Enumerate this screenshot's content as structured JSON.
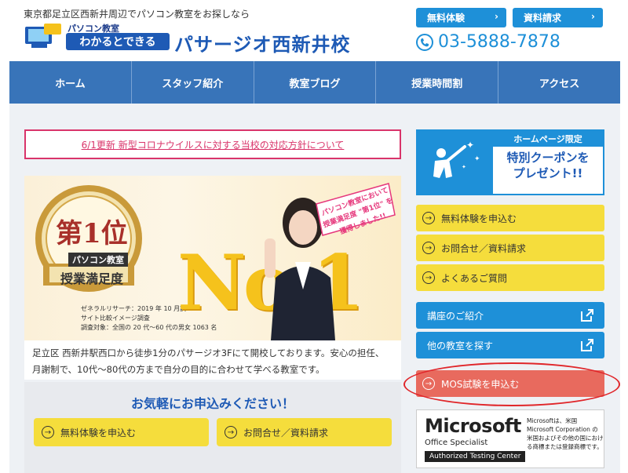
{
  "header": {
    "tagline": "東京都足立区西新井周辺でパソコン教室をお探しなら",
    "logo_top": "パソコン教室",
    "logo_main": "わかるとできる",
    "school_name": "パサージオ西新井校",
    "trial_button": "無料体験",
    "docs_button": "資料請求",
    "phone": "03-5888-7878"
  },
  "nav": {
    "items": [
      "ホーム",
      "スタッフ紹介",
      "教室ブログ",
      "授業時間割",
      "アクセス"
    ]
  },
  "notice": {
    "text": "6/1更新 新型コロナウイルスに対する当校の対応方針について"
  },
  "hero": {
    "rank_big": "第1位",
    "rank_sub": "パソコン教室",
    "rank_title": "授業満足度",
    "research_1": "ゼネラルリサーチ：2019 年 10 月調べ",
    "research_2": "サイト比較イメージ調査",
    "research_3": "調査対象：全国の 20 代～60 代の男女 1063 名",
    "big_text": "No.1",
    "bubble_1": "パソコン教室において",
    "bubble_2": "授業満足度 \"第1位\" を",
    "bubble_3": "獲得しました!!"
  },
  "description": {
    "line1": "足立区 西新井駅西口から徒歩1分のパサージオ3Fにて開校しております。安心の担任、",
    "line2": "月謝制で、10代～80代の方まで自分の目的に合わせて学べる教室です。"
  },
  "apply": {
    "title": "お気軽にお申込みください！",
    "trial": "無料体験を申込む",
    "inquiry": "お問合せ／資料請求"
  },
  "sidebar": {
    "coupon_head": "ホームページ限定",
    "coupon_body_1": "特別クーポンを",
    "coupon_body_2": "プレゼント!!",
    "trial": "無料体験を申込む",
    "inquiry": "お問合せ／資料請求",
    "faq": "よくあるご質問",
    "courses": "講座のご紹介",
    "other_schools": "他の教室を探す",
    "mos": "MOS試験を申込む"
  },
  "microsoft": {
    "logo": "Microsoft",
    "sub": "Office Specialist",
    "atc": "Authorized Testing Center",
    "note": "Microsoftは、米国 Microsoft Corporation の米国およびその他の国における商標または登録商標です。"
  },
  "colors": {
    "brand_blue": "#1e90d8",
    "nav_blue": "#3874b9",
    "yellow": "#f5dd3c",
    "red": "#e86a5e",
    "pink": "#d9346a"
  }
}
